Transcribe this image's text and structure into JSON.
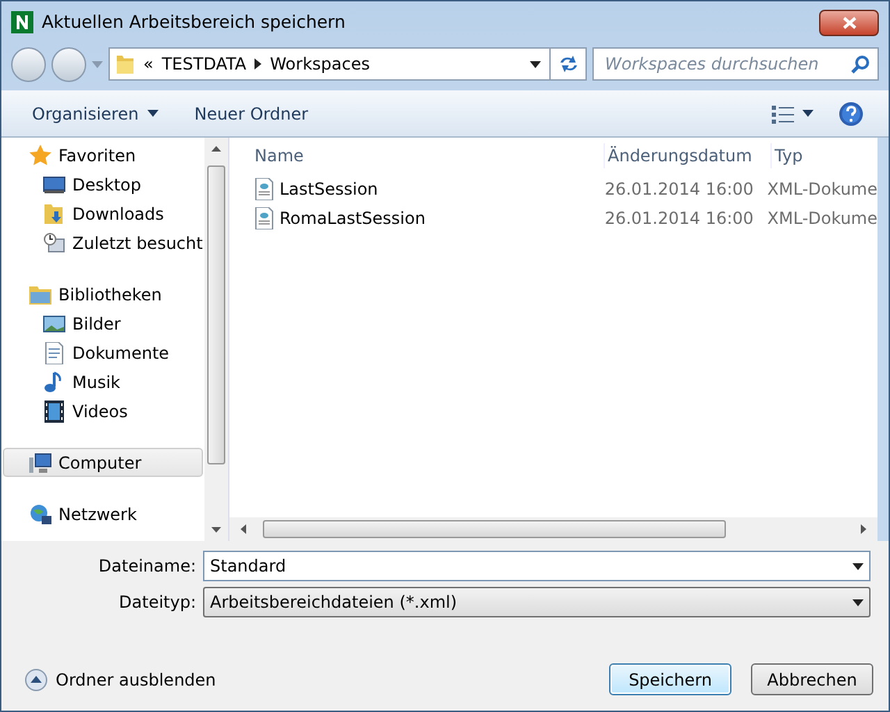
{
  "window": {
    "title": "Aktuellen Arbeitsbereich speichern"
  },
  "address": {
    "overflow": "«",
    "crumbs": [
      "TESTDATA",
      "Workspaces"
    ]
  },
  "search": {
    "placeholder": "Workspaces durchsuchen"
  },
  "toolbar": {
    "organize": "Organisieren",
    "new_folder": "Neuer Ordner"
  },
  "nav": [
    {
      "label": "Favoriten",
      "kind": "star",
      "selected": false,
      "children": [
        {
          "label": "Desktop",
          "kind": "desktop",
          "selected": false
        },
        {
          "label": "Downloads",
          "kind": "downloads",
          "selected": false
        },
        {
          "label": "Zuletzt besucht",
          "kind": "recent",
          "selected": false
        }
      ]
    },
    {
      "label": "Bibliotheken",
      "kind": "library",
      "selected": false,
      "children": [
        {
          "label": "Bilder",
          "kind": "pictures",
          "selected": false
        },
        {
          "label": "Dokumente",
          "kind": "documents",
          "selected": false
        },
        {
          "label": "Musik",
          "kind": "music",
          "selected": false
        },
        {
          "label": "Videos",
          "kind": "videos",
          "selected": false
        }
      ]
    },
    {
      "label": "Computer",
      "kind": "computer",
      "selected": true
    },
    {
      "label": "Netzwerk",
      "kind": "network",
      "selected": false
    }
  ],
  "columns": [
    "Name",
    "Änderungsdatum",
    "Typ"
  ],
  "files": [
    {
      "name": "LastSession",
      "date": "26.01.2014 16:00",
      "type": "XML-Dokume"
    },
    {
      "name": "RomaLastSession",
      "date": "26.01.2014 16:00",
      "type": "XML-Dokume"
    }
  ],
  "filename": {
    "label": "Dateiname:",
    "value": "Standard"
  },
  "filetype": {
    "label": "Dateityp:",
    "value": "Arbeitsbereichdateien (*.xml)"
  },
  "hide_folders": "Ordner ausblenden",
  "buttons": [
    {
      "label": "Speichern",
      "default": true
    },
    {
      "label": "Abbrechen",
      "default": false
    }
  ]
}
